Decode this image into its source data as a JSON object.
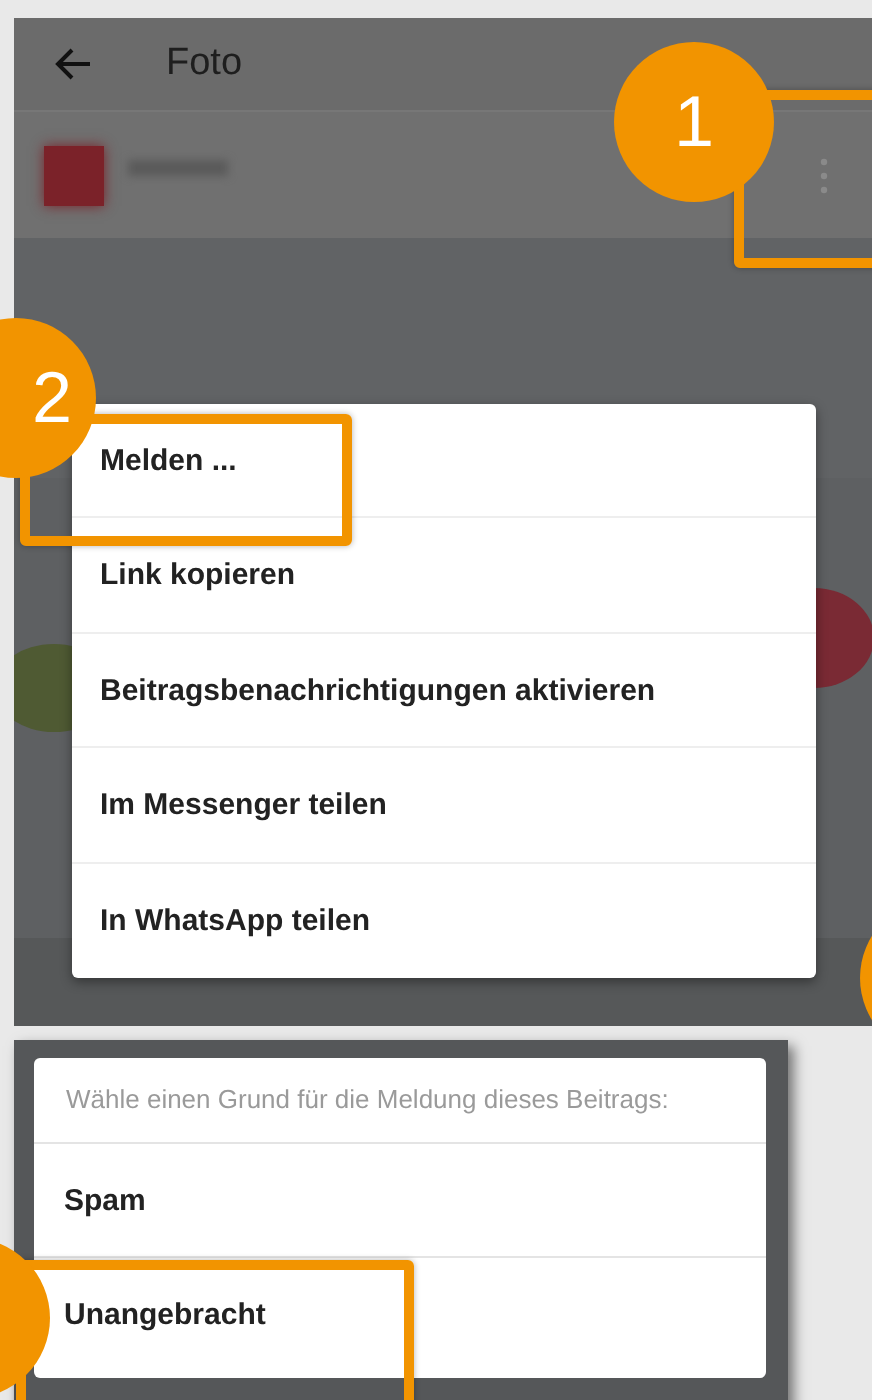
{
  "top_bar": {
    "title": "Foto"
  },
  "post_header": {
    "more_button": {
      "highlighted": true
    }
  },
  "menu": [
    {
      "label": "Melden ...",
      "highlighted": true
    },
    {
      "label": "Link kopieren",
      "highlighted": false
    },
    {
      "label": "Beitragsbenachrichtigungen aktivieren",
      "highlighted": false
    },
    {
      "label": "Im Messenger teilen",
      "highlighted": false
    },
    {
      "label": "In WhatsApp teilen",
      "highlighted": false
    }
  ],
  "report_dialog": {
    "prompt": "Wähle einen Grund für die Meldung dieses Beitrags:",
    "options": [
      {
        "label": "Spam",
        "highlighted": false
      },
      {
        "label": "Unangebracht",
        "highlighted": true
      }
    ]
  },
  "callouts": [
    {
      "label": "1"
    },
    {
      "label": "2"
    }
  ]
}
